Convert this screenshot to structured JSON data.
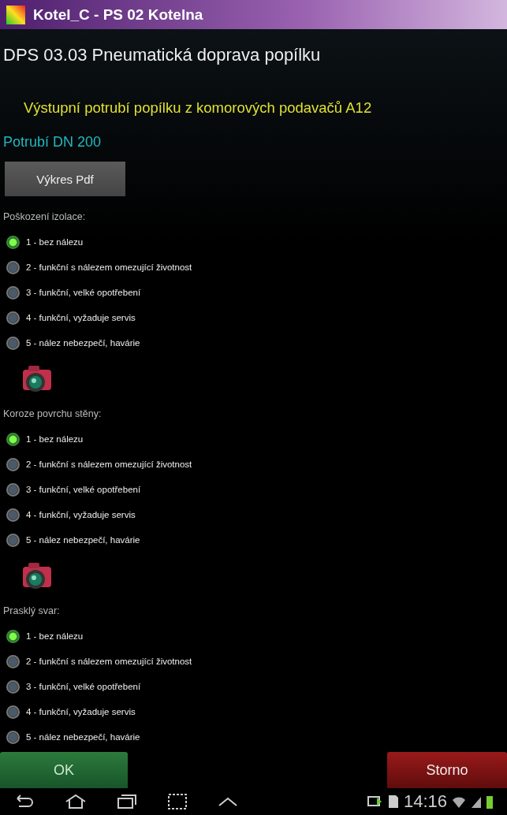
{
  "window": {
    "title": "Kotel_C - PS 02 Kotelna"
  },
  "heading": "DPS 03.03 Pneumatická doprava popílku",
  "subtitle": "Výstupní potrubí popílku z komorových podavačů A12",
  "pipe": "Potrubí DN 200",
  "drawing_button": "Výkres Pdf",
  "sections": [
    {
      "label": "Poškození izolace:",
      "camera": true,
      "options": [
        {
          "label": "1 - bez nálezu",
          "selected": true
        },
        {
          "label": "2 - funkční s nálezem omezující životnost",
          "selected": false
        },
        {
          "label": "3 - funkční, velké opotřebení",
          "selected": false
        },
        {
          "label": "4 - funkční, vyžaduje servis",
          "selected": false
        },
        {
          "label": "5 - nález nebezpečí, havárie",
          "selected": false
        }
      ]
    },
    {
      "label": "Koroze povrchu stěny:",
      "camera": true,
      "options": [
        {
          "label": "1 - bez nálezu",
          "selected": true
        },
        {
          "label": "2 - funkční s nálezem omezující životnost",
          "selected": false
        },
        {
          "label": "3 - funkční, velké opotřebení",
          "selected": false
        },
        {
          "label": "4 - funkční, vyžaduje servis",
          "selected": false
        },
        {
          "label": "5 - nález nebezpečí, havárie",
          "selected": false
        }
      ]
    },
    {
      "label": "Prasklý svar:",
      "options": [
        {
          "label": "1 - bez nálezu",
          "selected": true
        },
        {
          "label": "2 - funkční s nálezem omezující životnost",
          "selected": false
        },
        {
          "label": "3 - funkční, velké opotřebení",
          "selected": false
        },
        {
          "label": "4 - funkční, vyžaduje servis",
          "selected": false
        },
        {
          "label": "5 - nález nebezpečí, havárie",
          "selected": false
        }
      ]
    }
  ],
  "buttons": {
    "ok": "OK",
    "cancel": "Storno"
  },
  "status_bar": {
    "time": "14:16"
  }
}
